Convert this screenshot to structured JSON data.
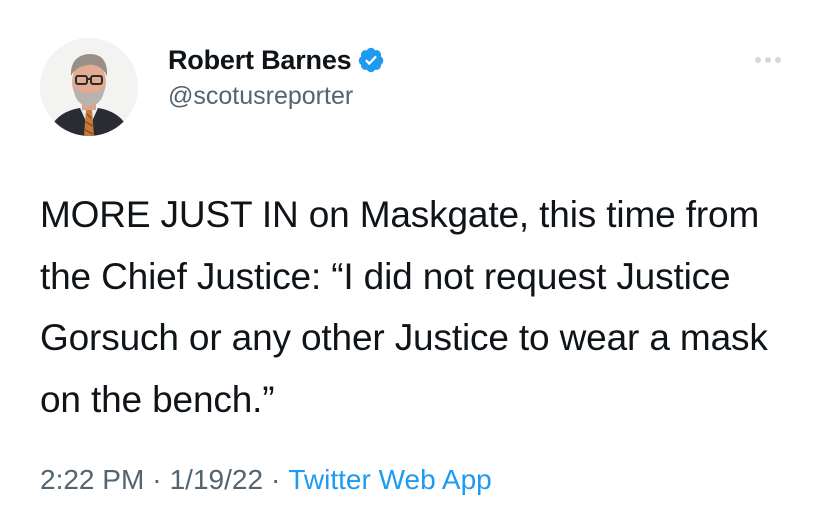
{
  "author": {
    "display_name": "Robert Barnes",
    "handle": "@scotusreporter",
    "verified_icon": "verified-badge-icon",
    "avatar_icon": "profile-photo"
  },
  "tweet": {
    "text": "MORE JUST IN on Maskgate, this time from the Chief Justice: “I did not request Justice Gorsuch or any other Justice to wear a mask on the bench.”"
  },
  "meta": {
    "time": "2:22 PM",
    "separator": "·",
    "date": "1/19/22",
    "source": "Twitter Web App"
  },
  "menu": {
    "icon": "more-options-icon"
  },
  "colors": {
    "text": "#0f1419",
    "secondary": "#536471",
    "link": "#1d9bf0",
    "verified": "#1d9bf0"
  }
}
